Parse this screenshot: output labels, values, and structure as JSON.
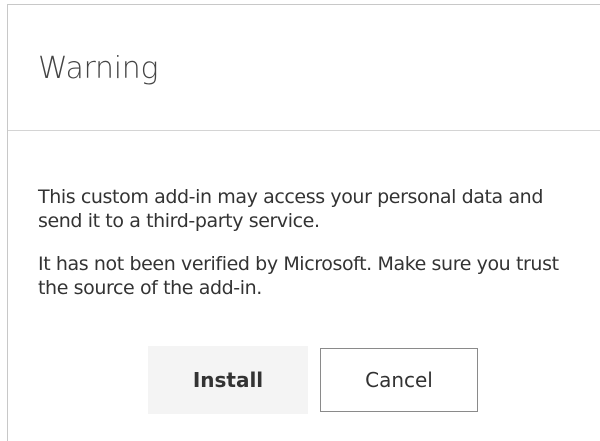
{
  "dialog": {
    "title": "Warning",
    "messages": [
      "This custom add-in may access your personal data and send it to a third-party service.",
      "It has not been verified by Microsoft. Make sure you trust the source of the add-in."
    ],
    "buttons": {
      "install_label": "Install",
      "cancel_label": "Cancel"
    }
  },
  "colors": {
    "install_button_bg": "#f4f4f4",
    "cancel_button_border": "#8a8a8a",
    "divider": "#d4d4d4",
    "text": "#333333"
  }
}
